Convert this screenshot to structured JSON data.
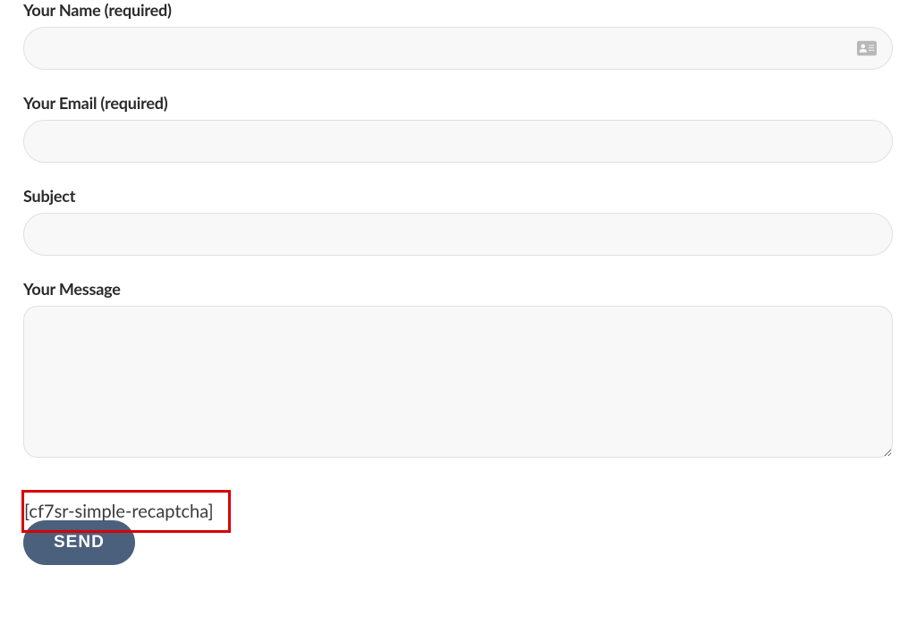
{
  "form": {
    "name": {
      "label": "Your Name (required)",
      "value": ""
    },
    "email": {
      "label": "Your Email (required)",
      "value": ""
    },
    "subject": {
      "label": "Subject",
      "value": ""
    },
    "message": {
      "label": "Your Message",
      "value": ""
    },
    "captcha_shortcode": "[cf7sr-simple-recaptcha]",
    "submit_label": "SEND"
  }
}
